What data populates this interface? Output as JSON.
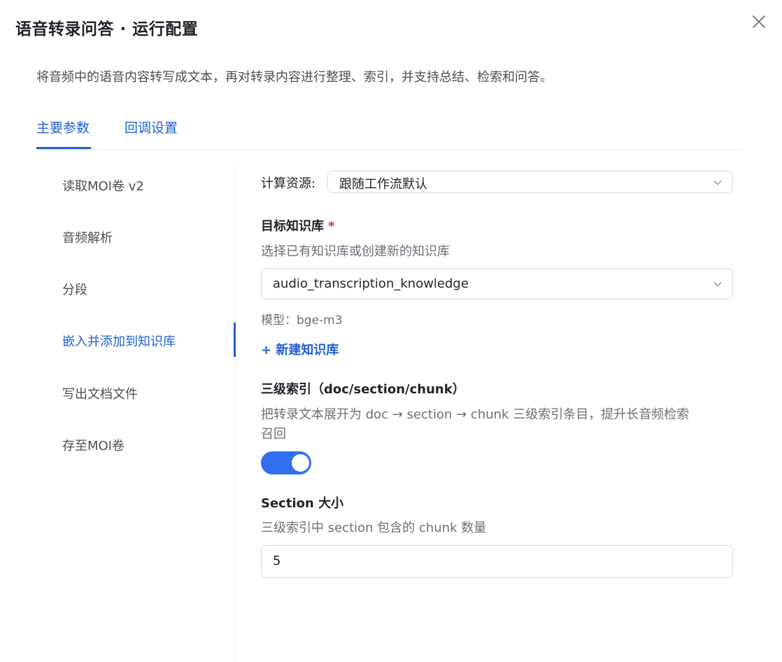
{
  "dialog": {
    "title": "语音转录问答 · 运行配置",
    "description": "将音频中的语音内容转写成文本，再对转录内容进行整理、索引，并支持总结、检索和问答。"
  },
  "tabs": [
    {
      "label": "主要参数",
      "active": true
    },
    {
      "label": "回调设置",
      "active": false
    }
  ],
  "side_nav": {
    "items": [
      {
        "label": "读取MOI卷 v2"
      },
      {
        "label": "音频解析"
      },
      {
        "label": "分段"
      },
      {
        "label": "嵌入并添加到知识库",
        "active": true
      },
      {
        "label": "写出文档文件"
      },
      {
        "label": "存至MOI卷"
      }
    ]
  },
  "form": {
    "compute": {
      "label": "计算资源:",
      "value": "跟随工作流默认"
    },
    "kb": {
      "label": "目标知识库",
      "required_mark": "*",
      "hint": "选择已有知识库或创建新的知识库",
      "value": "audio_transcription_knowledge",
      "model_note": "模型：bge-m3",
      "new_link": "+ 新建知识库"
    },
    "index": {
      "label": "三级索引（doc/section/chunk）",
      "hint_line1": "把转录文本展开为 doc → section → chunk 三级索引条目，提升长音频检索",
      "hint_line2": "召回",
      "enabled": true
    },
    "section": {
      "label": "Section 大小",
      "hint": "三级索引中 section 包含的 chunk 数量",
      "value": "5"
    }
  },
  "colors": {
    "accent": "#1f5fd6",
    "toggle_on": "#2f6ff0",
    "required": "#e0282e"
  }
}
